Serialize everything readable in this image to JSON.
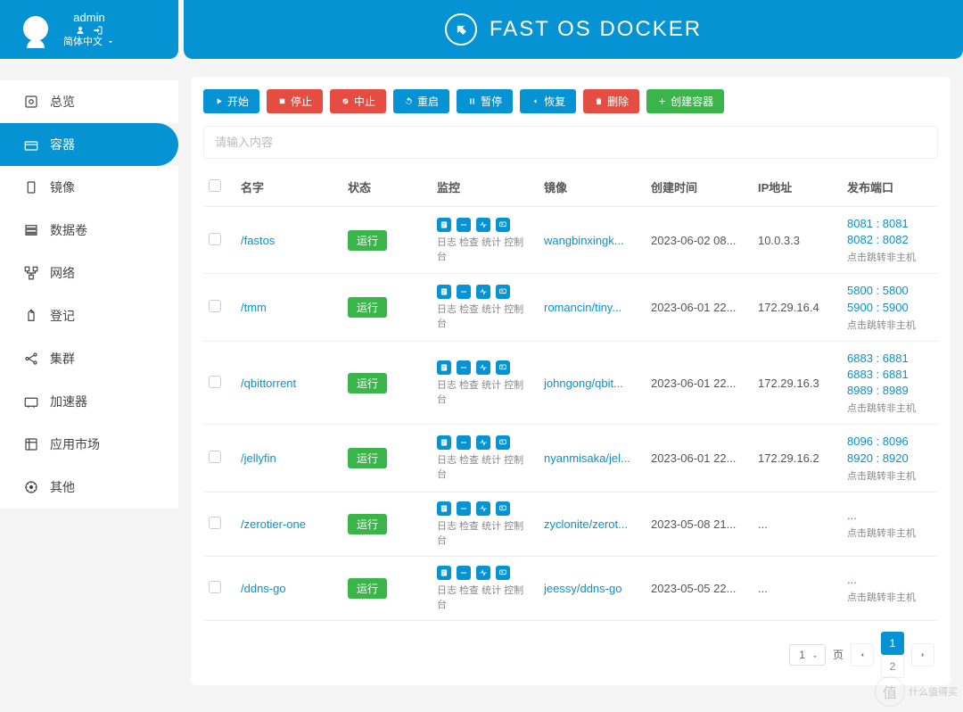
{
  "header": {
    "username": "admin",
    "language": "简体中文",
    "brand": "FAST OS DOCKER"
  },
  "sidebar": {
    "items": [
      {
        "icon": "overview",
        "label": "总览"
      },
      {
        "icon": "container",
        "label": "容器"
      },
      {
        "icon": "image",
        "label": "镜像"
      },
      {
        "icon": "volume",
        "label": "数据卷"
      },
      {
        "icon": "network",
        "label": "网络"
      },
      {
        "icon": "registry",
        "label": "登记"
      },
      {
        "icon": "cluster",
        "label": "集群"
      },
      {
        "icon": "accel",
        "label": "加速器"
      },
      {
        "icon": "market",
        "label": "应用市场"
      },
      {
        "icon": "other",
        "label": "其他"
      }
    ],
    "active_index": 1
  },
  "toolbar": {
    "start": "开始",
    "stop": "停止",
    "kill": "中止",
    "restart": "重启",
    "pause": "暂停",
    "resume": "恢复",
    "delete": "删除",
    "create": "创建容器"
  },
  "search": {
    "placeholder": "请输入内容"
  },
  "table": {
    "cols": {
      "name": "名字",
      "status": "状态",
      "monitor": "监控",
      "image": "镜像",
      "created": "创建时间",
      "ip": "IP地址",
      "ports": "发布端口"
    },
    "monitor_labels": "日志 检查 统计 控制台",
    "port_hint": "点击跳转非主机",
    "rows": [
      {
        "name": "/fastos",
        "status": "运行",
        "image": "wangbinxingk...",
        "created": "2023-06-02 08...",
        "ip": "10.0.3.3",
        "ports": "8081 : 8081 8082 : 8082"
      },
      {
        "name": "/tmm",
        "status": "运行",
        "image": "romancin/tiny...",
        "created": "2023-06-01 22...",
        "ip": "172.29.16.4",
        "ports": "5800 : 5800 5900 : 5900"
      },
      {
        "name": "/qbittorrent",
        "status": "运行",
        "image": "johngong/qbit...",
        "created": "2023-06-01 22...",
        "ip": "172.29.16.3",
        "ports": "6883 : 6881 6883 : 6881 8989 : 8989"
      },
      {
        "name": "/jellyfin",
        "status": "运行",
        "image": "nyanmisaka/jel...",
        "created": "2023-06-01 22...",
        "ip": "172.29.16.2",
        "ports": "8096 : 8096 8920 : 8920"
      },
      {
        "name": "/zerotier-one",
        "status": "运行",
        "image": "zyclonite/zerot...",
        "created": "2023-05-08 21...",
        "ip": "...",
        "ports": "..."
      },
      {
        "name": "/ddns-go",
        "status": "运行",
        "image": "jeessy/ddns-go",
        "created": "2023-05-05 22...",
        "ip": "...",
        "ports": "..."
      }
    ]
  },
  "pager": {
    "page_size": "1",
    "label": "页",
    "pages": [
      "1",
      "2"
    ],
    "current": 1
  },
  "watermark": "什么值得买"
}
